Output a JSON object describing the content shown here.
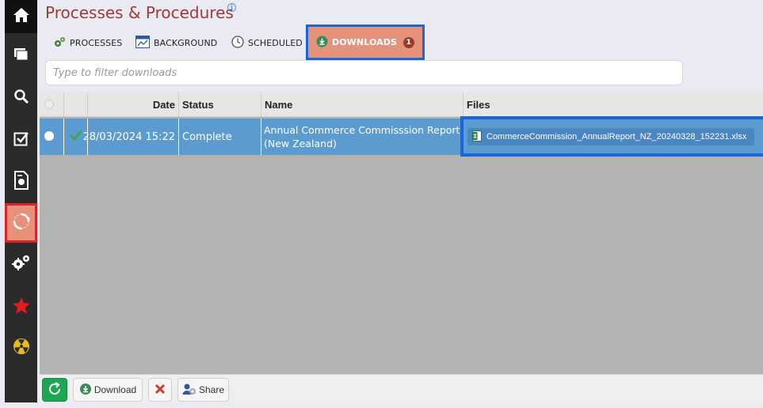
{
  "page": {
    "title": "Processes & Procedures",
    "info": "i"
  },
  "tabs": [
    {
      "label": "PROCESSES",
      "icon": "gears-icon"
    },
    {
      "label": "BACKGROUND",
      "icon": "background-chart-icon"
    },
    {
      "label": "SCHEDULED",
      "icon": "clock-icon"
    },
    {
      "label": "DOWNLOADS",
      "icon": "download-circle-icon",
      "badge": "1",
      "active": true
    }
  ],
  "filter": {
    "placeholder": "Type to filter downloads",
    "value": ""
  },
  "grid": {
    "columns": [
      "",
      "",
      "Date",
      "Status",
      "Name",
      "Files"
    ],
    "rows": [
      {
        "selected": true,
        "status_check": true,
        "date": "28/03/2024 15:22",
        "status": "Complete",
        "name": "Annual Commerce Commisssion Report (New Zealand)",
        "file": "CommerceCommission_AnnualReport_NZ_20240328_152231.xlsx"
      }
    ]
  },
  "toolbar": {
    "download_label": "Download",
    "share_label": "Share"
  },
  "sidebar": {
    "items": [
      "home-icon",
      "windows-icon",
      "search-icon",
      "tasks-checkbox-icon",
      "report-icon",
      "processes-sync-icon",
      "settings-gears-icon",
      "favorites-star-icon",
      "radiation-icon"
    ]
  },
  "colors": {
    "sidebar_bg": "#2b2b2b",
    "accent_orange": "#e3927b",
    "highlight_blue": "#1a66d8",
    "row_selected": "#5b9bd0",
    "title_red": "#9e3a3a"
  }
}
